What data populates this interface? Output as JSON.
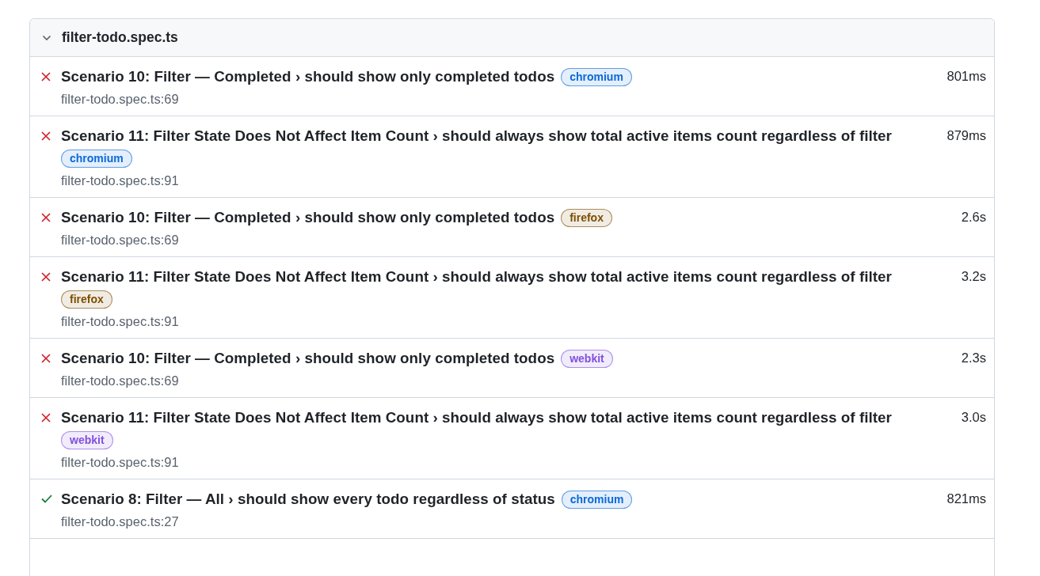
{
  "file": {
    "name": "filter-todo.spec.ts",
    "expanded": true
  },
  "tests": [
    {
      "failed": true,
      "title": "Scenario 10: Filter — Completed › should show only completed todos",
      "project": {
        "label": "chromium",
        "color": "#0969da"
      },
      "duration": "801ms",
      "location": "filter-todo.spec.ts:69"
    },
    {
      "failed": true,
      "title": "Scenario 11: Filter State Does Not Affect Item Count › should always show total active items count regardless of filter",
      "project": {
        "label": "chromium",
        "color": "#0969da"
      },
      "duration": "879ms",
      "location": "filter-todo.spec.ts:91"
    },
    {
      "failed": true,
      "title": "Scenario 10: Filter — Completed › should show only completed todos",
      "project": {
        "label": "firefox",
        "color": "#7d4e00"
      },
      "duration": "2.6s",
      "location": "filter-todo.spec.ts:69"
    },
    {
      "failed": true,
      "title": "Scenario 11: Filter State Does Not Affect Item Count › should always show total active items count regardless of filter",
      "project": {
        "label": "firefox",
        "color": "#7d4e00"
      },
      "duration": "3.2s",
      "location": "filter-todo.spec.ts:91"
    },
    {
      "failed": true,
      "title": "Scenario 10: Filter — Completed › should show only completed todos",
      "project": {
        "label": "webkit",
        "color": "#8250df"
      },
      "duration": "2.3s",
      "location": "filter-todo.spec.ts:69"
    },
    {
      "failed": true,
      "title": "Scenario 11: Filter State Does Not Affect Item Count › should always show total active items count regardless of filter",
      "project": {
        "label": "webkit",
        "color": "#8250df"
      },
      "duration": "3.0s",
      "location": "filter-todo.spec.ts:91"
    },
    {
      "failed": false,
      "title": "Scenario 8: Filter — All › should show every todo regardless of status",
      "project": {
        "label": "chromium",
        "color": "#0969da"
      },
      "duration": "821ms",
      "location": "filter-todo.spec.ts:27"
    }
  ]
}
